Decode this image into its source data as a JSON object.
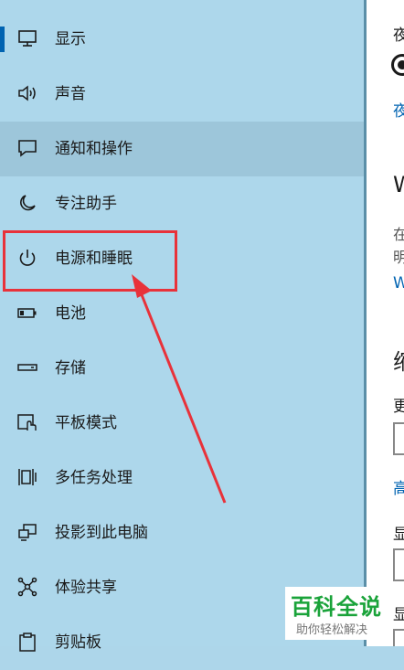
{
  "sidebar": {
    "items": [
      {
        "label": "显示",
        "icon": "monitor-icon"
      },
      {
        "label": "声音",
        "icon": "speaker-icon"
      },
      {
        "label": "通知和操作",
        "icon": "notification-icon"
      },
      {
        "label": "专注助手",
        "icon": "moon-icon"
      },
      {
        "label": "电源和睡眠",
        "icon": "power-icon"
      },
      {
        "label": "电池",
        "icon": "battery-icon"
      },
      {
        "label": "存储",
        "icon": "storage-icon"
      },
      {
        "label": "平板模式",
        "icon": "tablet-icon"
      },
      {
        "label": "多任务处理",
        "icon": "multitask-icon"
      },
      {
        "label": "投影到此电脑",
        "icon": "project-icon"
      },
      {
        "label": "体验共享",
        "icon": "share-icon"
      },
      {
        "label": "剪贴板",
        "icon": "clipboard-icon"
      }
    ],
    "selected_label": "显示",
    "hover_label": "通知和操作"
  },
  "right_pane": {
    "line1": "夜",
    "link1": "夜",
    "heading1": "W",
    "gray1": "在",
    "gray2": "明",
    "link2": "W",
    "heading2": "缩",
    "label1": "更",
    "link3": "高",
    "label2": "显",
    "label3": "显"
  },
  "annotation": {
    "highlight_color": "#e8323a",
    "target_label": "电源和睡眠"
  },
  "watermark": {
    "title": "百科全说",
    "subtitle": "助你轻松解决"
  },
  "colors": {
    "sidebar_bg": "#add7eb",
    "hover_bg": "#9dc6da",
    "accent": "#0063b1",
    "annotation_red": "#e8323a",
    "watermark_green": "#1aa33a"
  }
}
